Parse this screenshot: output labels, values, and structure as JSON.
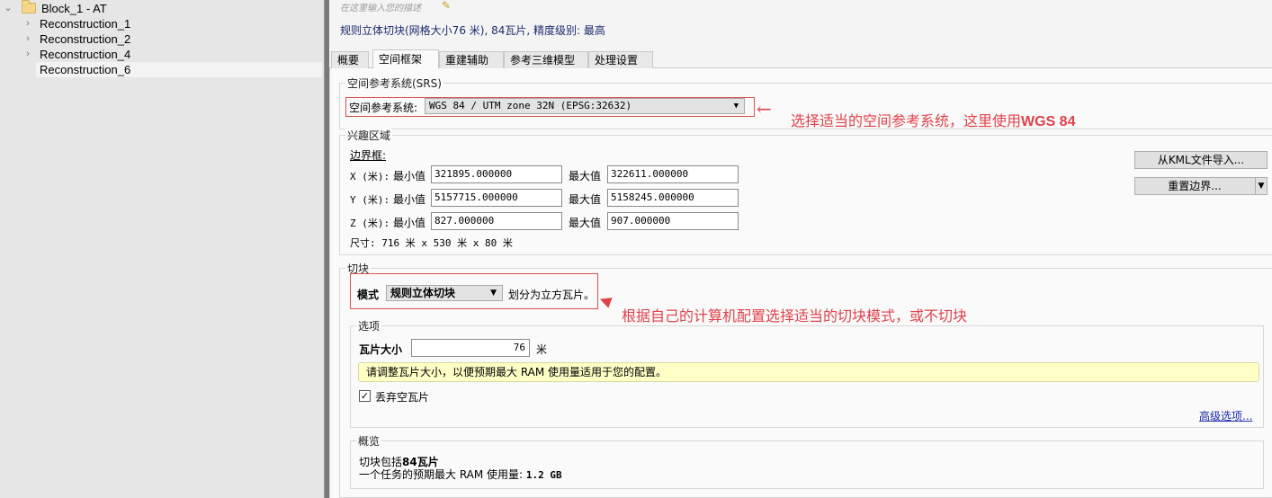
{
  "tree": {
    "root": {
      "label": "Block_1 - AT",
      "expanded": true
    },
    "items": [
      {
        "label": "Reconstruction_1",
        "expandable": true,
        "selected": false
      },
      {
        "label": "Reconstruction_2",
        "expandable": true,
        "selected": false
      },
      {
        "label": "Reconstruction_4",
        "expandable": true,
        "selected": false
      },
      {
        "label": "Reconstruction_6",
        "expandable": false,
        "selected": true
      }
    ]
  },
  "header": {
    "description_placeholder": "在这里输入您的描述",
    "summary": "规则立体切块(网格大小76 米), 84瓦片, 精度级别: 最高"
  },
  "tabs": [
    {
      "label": "概要",
      "active": false
    },
    {
      "label": "空间框架",
      "active": true
    },
    {
      "label": "重建辅助",
      "active": false
    },
    {
      "label": "参考三维模型",
      "active": false
    },
    {
      "label": "处理设置",
      "active": false
    }
  ],
  "srs": {
    "group_title": "空间参考系统(SRS)",
    "label": "空间参考系统:",
    "value": "WGS 84 / UTM zone 32N (EPSG:32632)"
  },
  "roi": {
    "group_title": "兴趣区域",
    "bbox_label": "边界框:",
    "min_label": "最小值",
    "max_label": "最大值",
    "rows": [
      {
        "axis": "X (米):",
        "min": "321895.000000",
        "max": "322611.000000"
      },
      {
        "axis": "Y (米):",
        "min": "5157715.000000",
        "max": "5158245.000000"
      },
      {
        "axis": "Z (米):",
        "min": "827.000000",
        "max": "907.000000"
      }
    ],
    "size_text": "尺寸: 716 米 x 530 米 x 80 米",
    "import_kml_button": "从KML文件导入...",
    "reset_bounds_button": "重置边界..."
  },
  "tiling": {
    "group_title": "切块",
    "mode_label": "模式",
    "mode_value": "规则立体切块",
    "mode_desc": "划分为立方瓦片。",
    "options": {
      "group_title": "选项",
      "tile_size_label": "瓦片大小",
      "tile_size_value": "76",
      "tile_size_unit": "米",
      "hint": "请调整瓦片大小，以便预期最大 RAM 使用量适用于您的配置。",
      "discard_empty_label": "丢弃空瓦片",
      "discard_empty_checked": true,
      "advanced_link": "高级选项..."
    },
    "overview": {
      "group_title": "概览",
      "line1_prefix": "切块包括",
      "line1_bold": "84瓦片",
      "line2_prefix": "一个任务的预期最大 RAM 使用量: ",
      "line2_bold": "1.2 GB"
    }
  },
  "annotations": {
    "srs_note": "选择适当的空间参考系统，这里使用",
    "srs_note_bold": "WGS 84",
    "tiling_note": "根据自己的计算机配置选择适当的切块模式，或不切块",
    "color": "#e0424a"
  }
}
